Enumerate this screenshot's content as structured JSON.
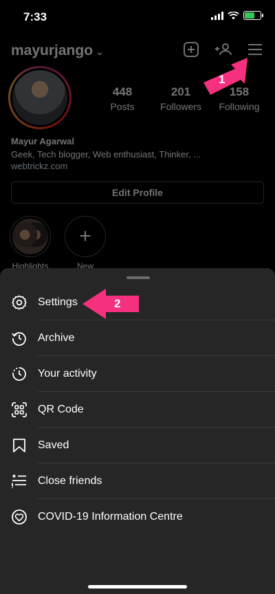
{
  "status_bar": {
    "time": "7:33"
  },
  "profile": {
    "username": "mayurjango",
    "stats": [
      {
        "value": "448",
        "label": "Posts"
      },
      {
        "value": "201",
        "label": "Followers"
      },
      {
        "value": "158",
        "label": "Following"
      }
    ],
    "full_name": "Mayur Agarwal",
    "bio": "Geek, Tech blogger, Web enthusiast, Thinker, ...",
    "website": "webtrickz.com",
    "edit_profile_label": "Edit Profile",
    "highlights": [
      {
        "label": "Highlights"
      },
      {
        "label": "New"
      }
    ]
  },
  "annotations": {
    "arrow_1": "1",
    "arrow_2": "2",
    "arrow_color": "#f5317f"
  },
  "menu": {
    "items": [
      {
        "label": "Settings",
        "icon": "gear-icon"
      },
      {
        "label": "Archive",
        "icon": "archive-icon"
      },
      {
        "label": "Your activity",
        "icon": "activity-icon"
      },
      {
        "label": "QR Code",
        "icon": "qr-code-icon"
      },
      {
        "label": "Saved",
        "icon": "bookmark-icon"
      },
      {
        "label": "Close friends",
        "icon": "close-friends-icon"
      },
      {
        "label": "COVID-19 Information Centre",
        "icon": "covid-info-icon"
      }
    ]
  }
}
